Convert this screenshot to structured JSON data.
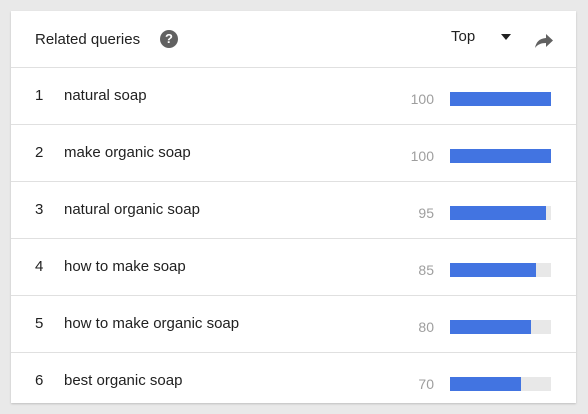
{
  "header": {
    "title": "Related queries",
    "help_icon": "question-mark-icon",
    "dropdown_label": "Top",
    "share_icon": "share-arrow-icon"
  },
  "colors": {
    "bar_fill": "#4274e1",
    "bar_track": "#e8e8e8",
    "value_text": "#9e9e9e"
  },
  "rows": [
    {
      "rank": "1",
      "query": "natural soap",
      "value": "100",
      "fraction": 1.0
    },
    {
      "rank": "2",
      "query": "make organic soap",
      "value": "100",
      "fraction": 1.0
    },
    {
      "rank": "3",
      "query": "natural organic soap",
      "value": "95",
      "fraction": 0.95
    },
    {
      "rank": "4",
      "query": "how to make soap",
      "value": "85",
      "fraction": 0.85
    },
    {
      "rank": "5",
      "query": "how to make organic soap",
      "value": "80",
      "fraction": 0.8
    },
    {
      "rank": "6",
      "query": "best organic soap",
      "value": "70",
      "fraction": 0.7
    }
  ]
}
